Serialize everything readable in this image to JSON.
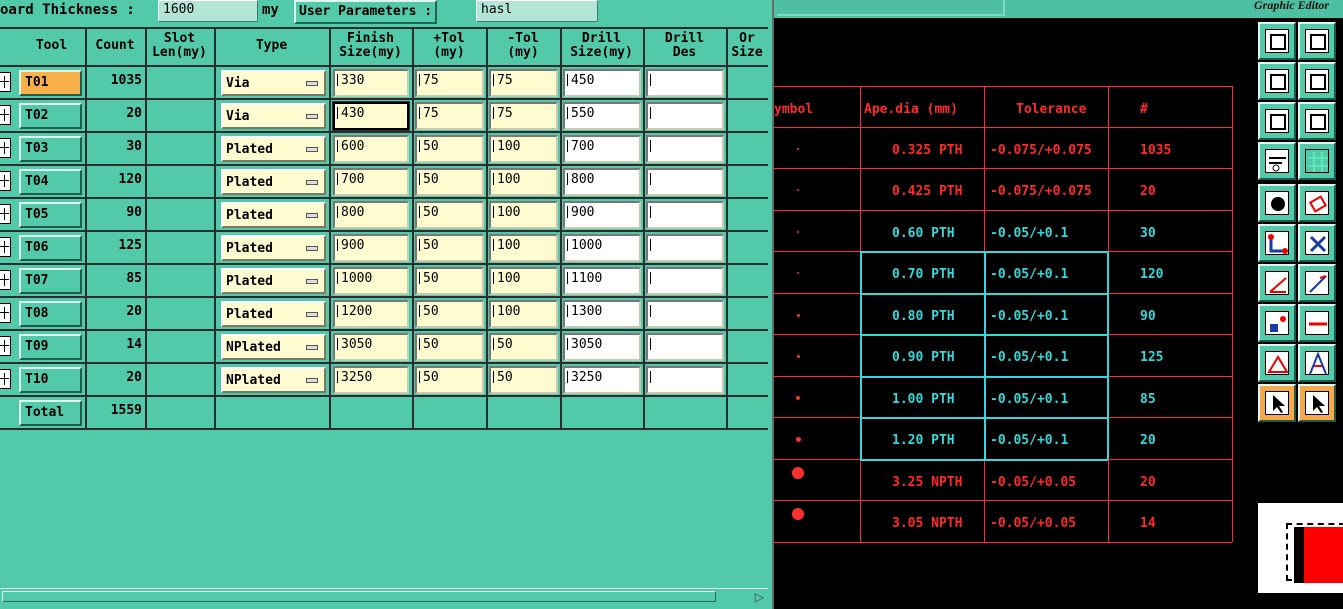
{
  "topbar": {
    "board_thickness_label": "oard Thickness :",
    "board_thickness_value": "1600",
    "unit": "my",
    "user_params_label": "User Parameters :",
    "user_params_value": "hasl"
  },
  "grid": {
    "headers": {
      "tool": "Tool",
      "count": "Count",
      "slot_len": "Slot\nLen(my)",
      "type": "Type",
      "finish_size": "Finish\nSize(my)",
      "plus_tol": "+Tol\n(my)",
      "minus_tol": "-Tol\n(my)",
      "drill_size": "Drill\nSize(my)",
      "drill_des": "Drill\nDes",
      "orig_size": "Or\nSize"
    },
    "rows": [
      {
        "tool": "T01",
        "count": "1035",
        "type": "Via",
        "finish": "330",
        "ptol": "75",
        "mtol": "75",
        "drill": "450",
        "des": ""
      },
      {
        "tool": "T02",
        "count": "20",
        "type": "Via",
        "finish": "430",
        "ptol": "75",
        "mtol": "75",
        "drill": "550",
        "des": ""
      },
      {
        "tool": "T03",
        "count": "30",
        "type": "Plated",
        "finish": "600",
        "ptol": "50",
        "mtol": "100",
        "drill": "700",
        "des": ""
      },
      {
        "tool": "T04",
        "count": "120",
        "type": "Plated",
        "finish": "700",
        "ptol": "50",
        "mtol": "100",
        "drill": "800",
        "des": ""
      },
      {
        "tool": "T05",
        "count": "90",
        "type": "Plated",
        "finish": "800",
        "ptol": "50",
        "mtol": "100",
        "drill": "900",
        "des": ""
      },
      {
        "tool": "T06",
        "count": "125",
        "type": "Plated",
        "finish": "900",
        "ptol": "50",
        "mtol": "100",
        "drill": "1000",
        "des": ""
      },
      {
        "tool": "T07",
        "count": "85",
        "type": "Plated",
        "finish": "1000",
        "ptol": "50",
        "mtol": "100",
        "drill": "1100",
        "des": ""
      },
      {
        "tool": "T08",
        "count": "20",
        "type": "Plated",
        "finish": "1200",
        "ptol": "50",
        "mtol": "100",
        "drill": "1300",
        "des": ""
      },
      {
        "tool": "T09",
        "count": "14",
        "type": "NPlated",
        "finish": "3050",
        "ptol": "50",
        "mtol": "50",
        "drill": "3050",
        "des": ""
      },
      {
        "tool": "T10",
        "count": "20",
        "type": "NPlated",
        "finish": "3250",
        "ptol": "50",
        "mtol": "50",
        "drill": "3250",
        "des": ""
      }
    ],
    "total_label": "Total",
    "total_count": "1559"
  },
  "editor": {
    "title": "Graphic Editor",
    "logo_text": "",
    "headers": {
      "symbol": "ymbol",
      "ape": "Ape.dia (mm)",
      "tol": "Tolerance",
      "count": "#"
    },
    "rows": [
      {
        "ape": "0.325 PTH",
        "tol": "-0.075/+0.075",
        "count": "1035"
      },
      {
        "ape": "0.425 PTH",
        "tol": "-0.075/+0.075",
        "count": "20"
      },
      {
        "ape": "0.60 PTH",
        "tol": "-0.05/+0.1",
        "count": "30"
      },
      {
        "ape": "0.70 PTH",
        "tol": "-0.05/+0.1",
        "count": "120"
      },
      {
        "ape": "0.80 PTH",
        "tol": "-0.05/+0.1",
        "count": "90"
      },
      {
        "ape": "0.90 PTH",
        "tol": "-0.05/+0.1",
        "count": "125"
      },
      {
        "ape": "1.00 PTH",
        "tol": "-0.05/+0.1",
        "count": "85"
      },
      {
        "ape": "1.20 PTH",
        "tol": "-0.05/+0.1",
        "count": "20"
      },
      {
        "ape": "3.25 NPTH",
        "tol": "-0.05/+0.05",
        "count": "20"
      },
      {
        "ape": "3.05 NPTH",
        "tol": "-0.05/+0.05",
        "count": "14"
      }
    ]
  },
  "colors": {
    "panel": "#52c9a9",
    "editor_red": "#ff2a2a",
    "highlight_cyan": "#34d8d8",
    "selected_tool": "#f7b04a"
  },
  "toolbox_icons": [
    "page-up-icon",
    "page-down-icon",
    "page-left-icon",
    "page-right-icon",
    "fit-icon",
    "zoom-fit-icon",
    "probe-icon",
    "grid-icon",
    "circle-icon",
    "rectangle-icon",
    "node-graph-icon",
    "cross-icon",
    "angle-line-icon",
    "diagonal-line-icon",
    "point-snap-icon",
    "horizontal-line-icon",
    "triangle-icon",
    "arrow-up-icon",
    "select-pointer-icon",
    "pointer-box-icon"
  ]
}
